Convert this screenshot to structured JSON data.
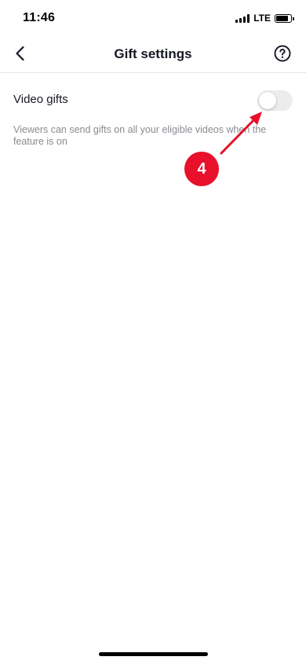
{
  "status_bar": {
    "time": "11:46",
    "carrier": "LTE"
  },
  "nav": {
    "title": "Gift settings",
    "back_icon": "chevron-left-icon",
    "help_icon": "question-circle-icon"
  },
  "settings": {
    "video_gifts_label": "Video gifts",
    "video_gifts_enabled": false,
    "video_gifts_description": "Viewers can send gifts on all your eligible videos when the feature is on"
  },
  "annotation": {
    "step_number": "4",
    "color": "#e8102a"
  }
}
